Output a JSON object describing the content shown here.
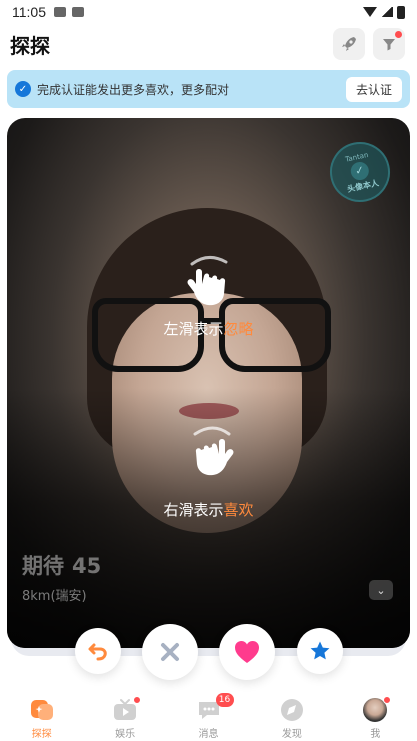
{
  "status_bar": {
    "time": "11:05"
  },
  "header": {
    "title": "探探"
  },
  "verify_banner": {
    "text": "完成认证能发出更多喜欢，更多配对",
    "button": "去认证"
  },
  "card": {
    "badge_top": "Tantan",
    "badge_bottom": "头像本人",
    "hint_left_prefix": "左滑表示",
    "hint_left_highlight": "忽略",
    "hint_right_prefix": "右滑表示",
    "hint_right_highlight": "喜欢",
    "name": "期待",
    "age": "45",
    "distance": "8km(瑞安)"
  },
  "actions": [
    "undo-icon",
    "close-icon",
    "heart-icon",
    "star-icon"
  ],
  "tabs": [
    {
      "label": "探探",
      "icon": "explore-icon"
    },
    {
      "label": "娱乐",
      "icon": "play-icon"
    },
    {
      "label": "消息",
      "icon": "chat-icon",
      "count": "16"
    },
    {
      "label": "发现",
      "icon": "compass-icon"
    },
    {
      "label": "我",
      "icon": "avatar"
    }
  ],
  "colors": {
    "accent": "#ff8a3d",
    "banner_bg": "#b9e3f7",
    "like": "#ff3b8d",
    "star": "#1677d9",
    "undo": "#ff8a3d",
    "badge_red": "#ff4d4f"
  }
}
